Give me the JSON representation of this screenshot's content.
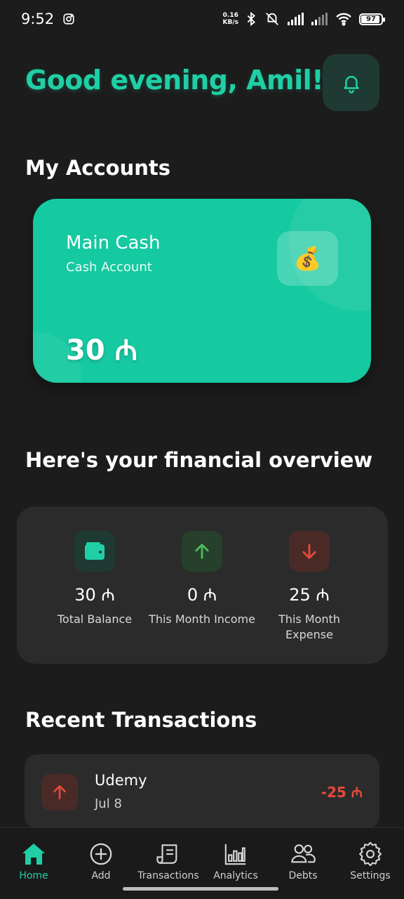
{
  "status_bar": {
    "time": "9:52",
    "net_speed_value": "0.16",
    "net_speed_unit": "KB/s",
    "battery": "97"
  },
  "header": {
    "greeting": "Good evening, Amil!",
    "accent_color": "#20cfa5"
  },
  "accounts": {
    "title": "My Accounts",
    "items": [
      {
        "name": "Main Cash",
        "type": "Cash Account",
        "balance": "30 ₼",
        "icon": "money-bag-icon",
        "color": "#15c9a0"
      }
    ]
  },
  "overview": {
    "title": "Here's your financial overview",
    "items": [
      {
        "value": "30 ₼",
        "label": "Total Balance",
        "icon": "wallet-icon"
      },
      {
        "value": "0 ₼",
        "label": "This Month Income",
        "icon": "arrow-up-icon"
      },
      {
        "value": "25 ₼",
        "label": "This Month Expense",
        "icon": "arrow-down-icon"
      }
    ]
  },
  "transactions": {
    "title": "Recent Transactions",
    "items": [
      {
        "title": "Udemy",
        "date": "Jul 8",
        "amount": "-25 ₼",
        "icon": "arrow-up-icon"
      }
    ]
  },
  "nav": {
    "items": [
      {
        "label": "Home",
        "icon": "home-icon",
        "active": true
      },
      {
        "label": "Add",
        "icon": "add-circle-icon"
      },
      {
        "label": "Transactions",
        "icon": "receipt-icon"
      },
      {
        "label": "Analytics",
        "icon": "bar-chart-icon"
      },
      {
        "label": "Debts",
        "icon": "people-icon"
      },
      {
        "label": "Settings",
        "icon": "gear-icon"
      }
    ]
  }
}
